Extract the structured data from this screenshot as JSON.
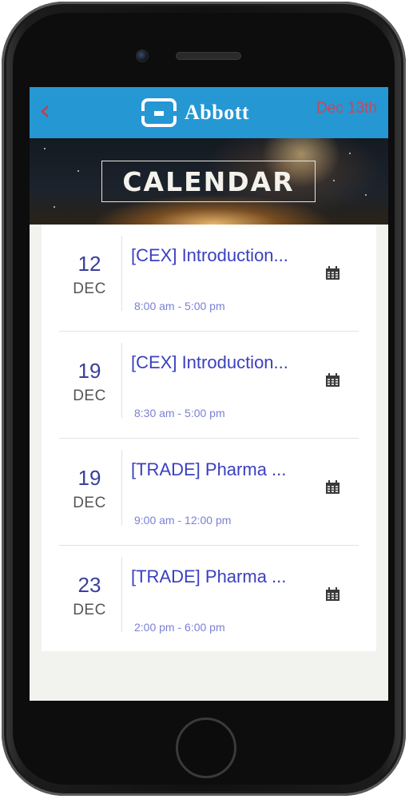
{
  "header": {
    "back_icon": "chevron-left-icon",
    "brand": "Abbott",
    "date_link": "Dec 13th",
    "accent_color": "#2597d3"
  },
  "banner": {
    "title": "CALENDAR"
  },
  "events": [
    {
      "day": "12",
      "month": "DEC",
      "title": "[CEX] Introduction...",
      "time": "8:00 am - 5:00 pm",
      "icon": "calendar-icon"
    },
    {
      "day": "19",
      "month": "DEC",
      "title": "[CEX] Introduction...",
      "time": "8:30 am - 5:00 pm",
      "icon": "calendar-icon"
    },
    {
      "day": "19",
      "month": "DEC",
      "title": "[TRADE] Pharma ...",
      "time": "9:00 am - 12:00 pm",
      "icon": "calendar-icon"
    },
    {
      "day": "23",
      "month": "DEC",
      "title": "[TRADE] Pharma ...",
      "time": "2:00 pm - 6:00 pm",
      "icon": "calendar-icon"
    }
  ]
}
